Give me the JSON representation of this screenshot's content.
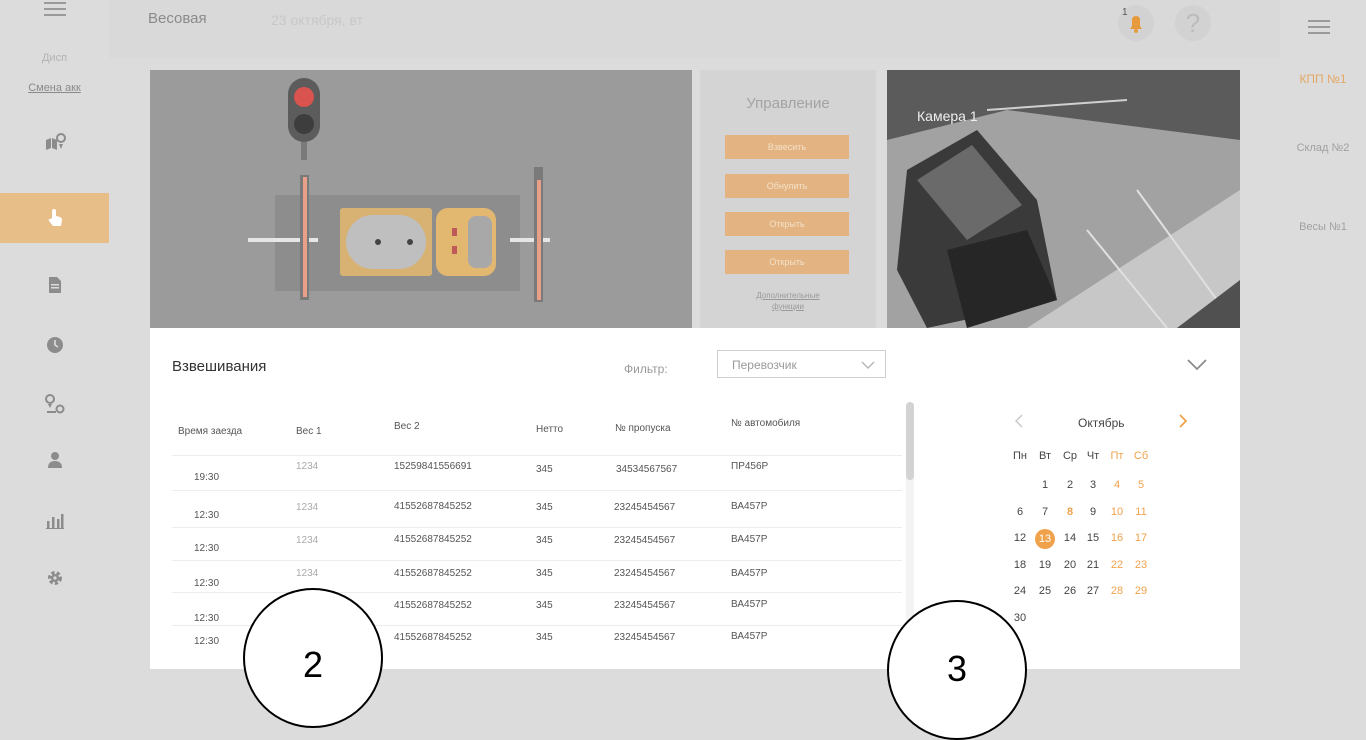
{
  "header": {
    "title": "Весовая",
    "date": "23 октября, вт",
    "notification_count": "1",
    "help_label": "?"
  },
  "left_sidebar": {
    "user_role": "Дисп",
    "switch_account": "Смена акк",
    "nav_icons": [
      "map-icon",
      "hand-icon",
      "document-icon",
      "clock-icon",
      "route-icon",
      "user-icon",
      "chart-icon",
      "gear-icon"
    ]
  },
  "right_sidebar": {
    "items": [
      {
        "label": "КПП №1"
      },
      {
        "label": "Склад №2"
      },
      {
        "label": "Весы №1"
      }
    ]
  },
  "control": {
    "title": "Управление",
    "buttons": [
      "Взвесить",
      "Обнулить",
      "Открыть",
      "Открыть"
    ],
    "more_link": "Дополнительные функции"
  },
  "camera": {
    "label": "Камера 1"
  },
  "weighings": {
    "title": "Взвешивания",
    "filter_label": "Фильтр:",
    "filter_value": "Перевозчик",
    "columns": [
      "Время заезда",
      "Вес 1",
      "Вес 2",
      "Нетто",
      "№ пропуска",
      "№ автомобиля"
    ],
    "rows": [
      [
        "19:30",
        "1234",
        "15259841556691",
        "345",
        "34534567567",
        "ПР456Р"
      ],
      [
        "12:30",
        "1234",
        "41552687845252",
        "345",
        "23245454567",
        "ВА457Р"
      ],
      [
        "12:30",
        "1234",
        "41552687845252",
        "345",
        "23245454567",
        "ВА457Р"
      ],
      [
        "12:30",
        "1234",
        "41552687845252",
        "345",
        "23245454567",
        "ВА457Р"
      ],
      [
        "12:30",
        "",
        "41552687845252",
        "345",
        "23245454567",
        "ВА457Р"
      ],
      [
        "12:30",
        "",
        "41552687845252",
        "345",
        "23245454567",
        "ВА457Р"
      ]
    ]
  },
  "calendar": {
    "month": "Октябрь",
    "weekdays": [
      "Пн",
      "Вт",
      "Ср",
      "Чт",
      "Пт",
      "Сб"
    ],
    "weeks": [
      [
        "",
        "1",
        "2",
        "3",
        "4",
        "5"
      ],
      [
        "6",
        "7",
        "8",
        "9",
        "10",
        "11"
      ],
      [
        "12",
        "13",
        "14",
        "15",
        "16",
        "17"
      ],
      [
        "18",
        "19",
        "20",
        "21",
        "22",
        "23"
      ],
      [
        "24",
        "25",
        "26",
        "27",
        "28",
        "29"
      ],
      [
        "30",
        "",
        "",
        "",
        "",
        ""
      ]
    ],
    "selected_day": "13",
    "highlight_day": "8"
  },
  "annotations": [
    "2",
    "3"
  ],
  "colors": {
    "accent": "#f0a24b",
    "button": "#e3b482",
    "selected_day": "#f0a24b"
  }
}
